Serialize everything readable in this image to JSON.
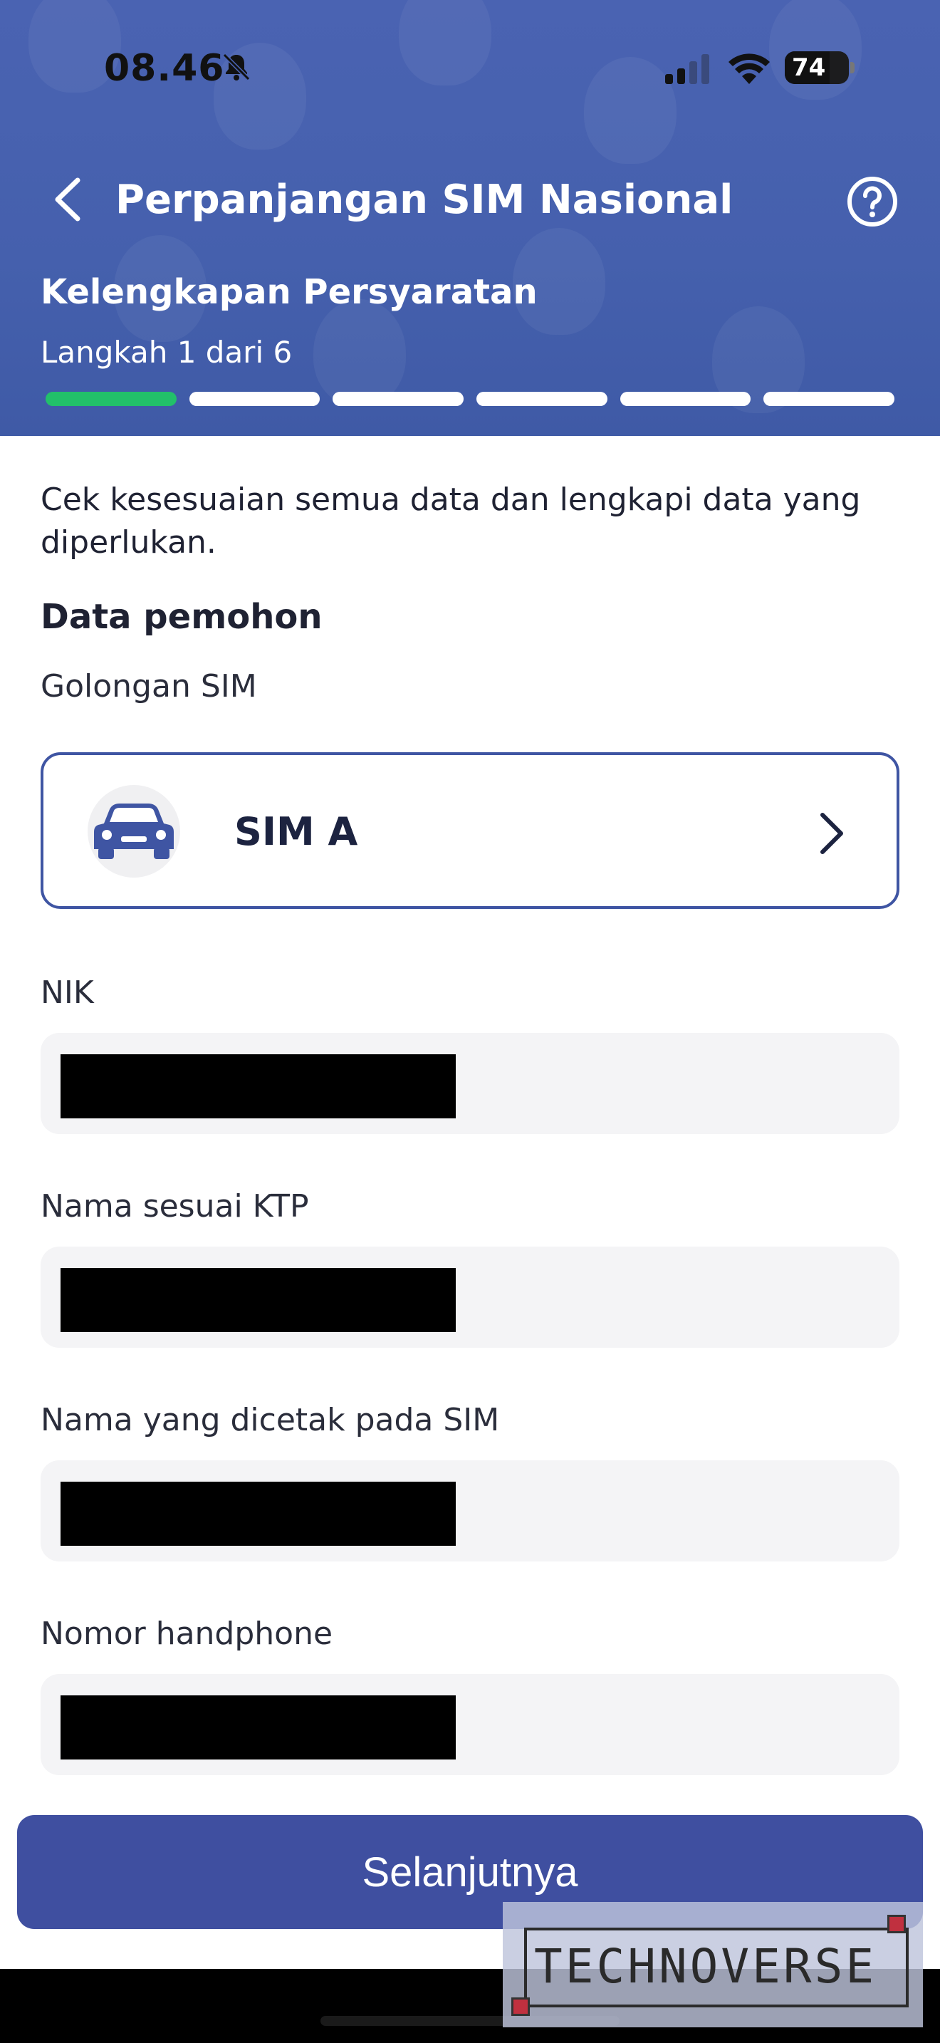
{
  "status_bar": {
    "time": "08.46",
    "battery": "74"
  },
  "header": {
    "title": "Perpanjangan SIM Nasional",
    "section_title": "Kelengkapan Persyaratan",
    "step_text": "Langkah 1 dari 6",
    "progress": {
      "current": 1,
      "total": 6
    }
  },
  "colors": {
    "header_bg": "#4a63b2",
    "progress_done": "#22c06a",
    "primary_button": "#3f4fa0",
    "card_border": "#3f55a3"
  },
  "main": {
    "intro": "Cek kesesuaian semua data dan lengkapi data yang diperlukan.",
    "subheading": "Data pemohon",
    "sim_label": "Golongan SIM",
    "sim_value": "SIM A",
    "sim_icon": "car-icon",
    "fields": [
      {
        "label": "NIK"
      },
      {
        "label": "Nama sesuai KTP"
      },
      {
        "label": "Nama yang dicetak pada SIM"
      },
      {
        "label": "Nomor handphone"
      }
    ],
    "next_label": "Selanjutnya"
  },
  "watermark": {
    "text": "TECHNOVERSE"
  }
}
